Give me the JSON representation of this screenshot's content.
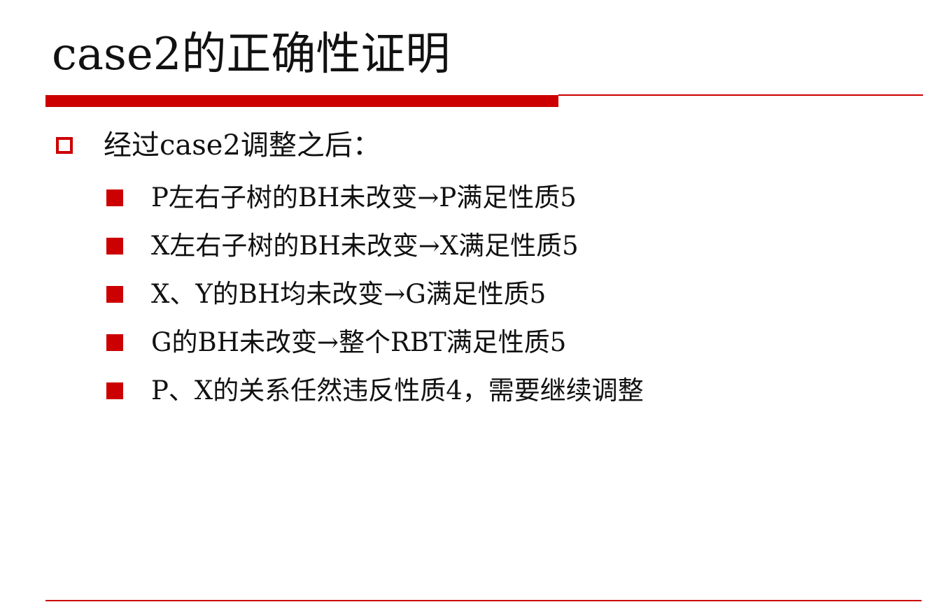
{
  "slide": {
    "title": "case2的正确性证明",
    "accent_color": "#cc0000",
    "bullet": {
      "icon": "hollow-square-bullet",
      "text": "经过case2调整之后："
    },
    "sub_bullets": [
      {
        "icon": "filled-square-bullet",
        "text": "P左右子树的BH未改变→P满足性质5"
      },
      {
        "icon": "filled-square-bullet",
        "text": "X左右子树的BH未改变→X满足性质5"
      },
      {
        "icon": "filled-square-bullet",
        "text": "X、Y的BH均未改变→G满足性质5"
      },
      {
        "icon": "filled-square-bullet",
        "text": "G的BH未改变→整个RBT满足性质5"
      },
      {
        "icon": "filled-square-bullet",
        "text": "P、X的关系任然违反性质4，需要继续调整"
      }
    ]
  }
}
